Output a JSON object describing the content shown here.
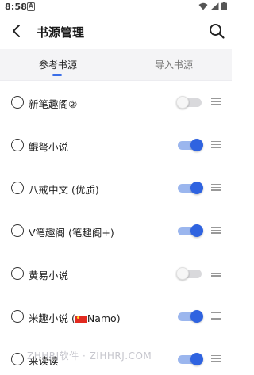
{
  "status_bar": {
    "time": "8:58",
    "notification_icon": "A"
  },
  "app_bar": {
    "title": "书源管理"
  },
  "tabs": [
    {
      "label": "参考书源",
      "selected": true
    },
    {
      "label": "导入书源",
      "selected": false
    }
  ],
  "sources": [
    {
      "name": "新笔趣阁②",
      "enabled": false
    },
    {
      "name": "鲲弩小说",
      "enabled": true
    },
    {
      "name": "八戒中文 (优质)",
      "enabled": true
    },
    {
      "name": "V笔趣阁 (笔趣阁+)",
      "enabled": true
    },
    {
      "name": "黄易小说",
      "enabled": false
    },
    {
      "name": "米趣小说 (",
      "name_suffix": "Namo)",
      "has_flag": true,
      "enabled": true
    },
    {
      "name": "来读读",
      "enabled": true
    }
  ],
  "watermark": "ZHHRJ软件 · ZIHHRJ.COM",
  "colors": {
    "accent": "#2f63e0",
    "track_on": "#9bb6ee",
    "track_off": "#d9d9dc"
  }
}
